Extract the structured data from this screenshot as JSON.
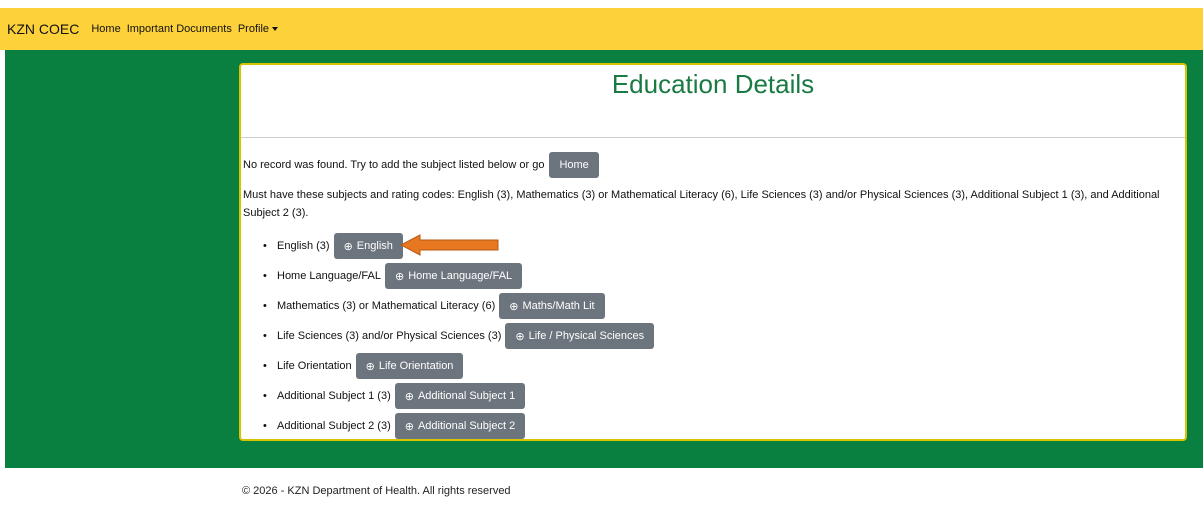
{
  "nav": {
    "brand": "KZN COEC",
    "links": [
      "Home",
      "Important Documents",
      "Profile"
    ]
  },
  "card": {
    "title": "Education Details",
    "no_record_text": "No record was found. Try to add the subject listed below or go",
    "home_button": "Home",
    "requirements": "Must have these subjects and rating codes: English (3), Mathematics (3) or Mathematical Literacy (6), Life Sciences (3) and/or Physical Sciences (3), Additional Subject 1 (3), and Additional Subject 2 (3).",
    "subjects": [
      {
        "label": "English (3)",
        "button": "English"
      },
      {
        "label": "Home Language/FAL",
        "button": "Home Language/FAL"
      },
      {
        "label": "Mathematics (3) or Mathematical Literacy (6)",
        "button": "Maths/Math Lit"
      },
      {
        "label": "Life Sciences (3) and/or Physical Sciences (3)",
        "button": "Life / Physical Sciences"
      },
      {
        "label": "Life Orientation",
        "button": "Life Orientation"
      },
      {
        "label": "Additional Subject 1 (3)",
        "button": "Additional Subject 1"
      },
      {
        "label": "Additional Subject 2 (3)",
        "button": "Additional Subject 2"
      }
    ]
  },
  "footer": "© 2026 - KZN Department of Health. All rights reserved",
  "colors": {
    "navbar": "#fdd13a",
    "background_green": "#0a8040",
    "button_gray": "#6c757d",
    "title_green": "#1a7a44",
    "card_border": "#d9c300",
    "arrow": "#e87722"
  },
  "icons": {
    "add": "circle-plus-icon",
    "pointer": "arrow-left-icon"
  }
}
